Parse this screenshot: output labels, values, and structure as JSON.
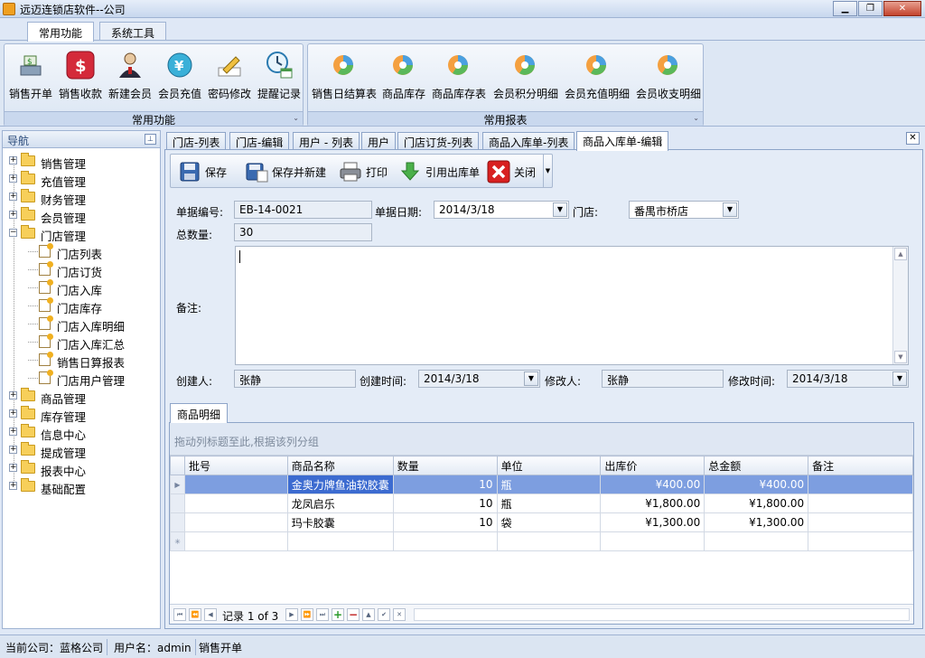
{
  "window": {
    "title": "远迈连锁店软件--公司"
  },
  "ribbon_tabs": [
    "常用功能",
    "系统工具"
  ],
  "ribbon": {
    "group1_caption": "常用功能",
    "group2_caption": "常用报表",
    "buttons": [
      "销售开单",
      "销售收款",
      "新建会员",
      "会员充值",
      "密码修改",
      "提醒记录"
    ],
    "reports": [
      "销售日结算表",
      "商品库存",
      "商品库存表",
      "会员积分明细",
      "会员充值明细",
      "会员收支明细"
    ]
  },
  "nav": {
    "title": "导航",
    "items": [
      "销售管理",
      "充值管理",
      "财务管理",
      "会员管理",
      "门店管理"
    ],
    "store_children": [
      "门店列表",
      "门店订货",
      "门店入库",
      "门店库存",
      "门店入库明细",
      "门店入库汇总",
      "销售日算报表",
      "门店用户管理"
    ],
    "items_after": [
      "商品管理",
      "库存管理",
      "信息中心",
      "提成管理",
      "报表中心",
      "基础配置"
    ]
  },
  "doc_tabs": [
    "门店-列表",
    "门店-编辑",
    "用户 - 列表",
    "用户",
    "门店订货-列表",
    "商品入库单-列表",
    "商品入库单-编辑"
  ],
  "toolbar": {
    "save": "保存",
    "save_new": "保存并新建",
    "print": "打印",
    "import_out": "引用出库单",
    "close": "关闭"
  },
  "form": {
    "doc_no_label": "单据编号:",
    "doc_no": "EB-14-0021",
    "doc_date_label": "单据日期:",
    "doc_date": "2014/3/18",
    "store_label": "门店:",
    "store": "番禺市桥店",
    "total_qty_label": "总数量:",
    "total_qty": "30",
    "memo_label": "备注:",
    "creator_label": "创建人:",
    "creator": "张静",
    "created_label": "创建时间:",
    "created": "2014/3/18",
    "modifier_label": "修改人:",
    "modifier": "张静",
    "modified_label": "修改时间:",
    "modified": "2014/3/18"
  },
  "detail": {
    "tab": "商品明细",
    "group_hint": "拖动列标题至此,根据该列分组",
    "columns": [
      "批号",
      "商品名称",
      "数量",
      "单位",
      "出库价",
      "总金额",
      "备注"
    ],
    "rows": [
      {
        "batch": "",
        "name": "金奥力牌鱼油软胶囊",
        "qty": "10",
        "unit": "瓶",
        "price": "¥400.00",
        "total": "¥400.00",
        "note": ""
      },
      {
        "batch": "",
        "name": "龙凤启乐",
        "qty": "10",
        "unit": "瓶",
        "price": "¥1,800.00",
        "total": "¥1,800.00",
        "note": ""
      },
      {
        "batch": "",
        "name": "玛卡胶囊",
        "qty": "10",
        "unit": "袋",
        "price": "¥1,300.00",
        "total": "¥1,300.00",
        "note": ""
      }
    ],
    "record_text": "记录 1 of 3"
  },
  "status": {
    "company": "当前公司：蓝格公司",
    "user": "用户名：admin",
    "action": "销售开单"
  }
}
